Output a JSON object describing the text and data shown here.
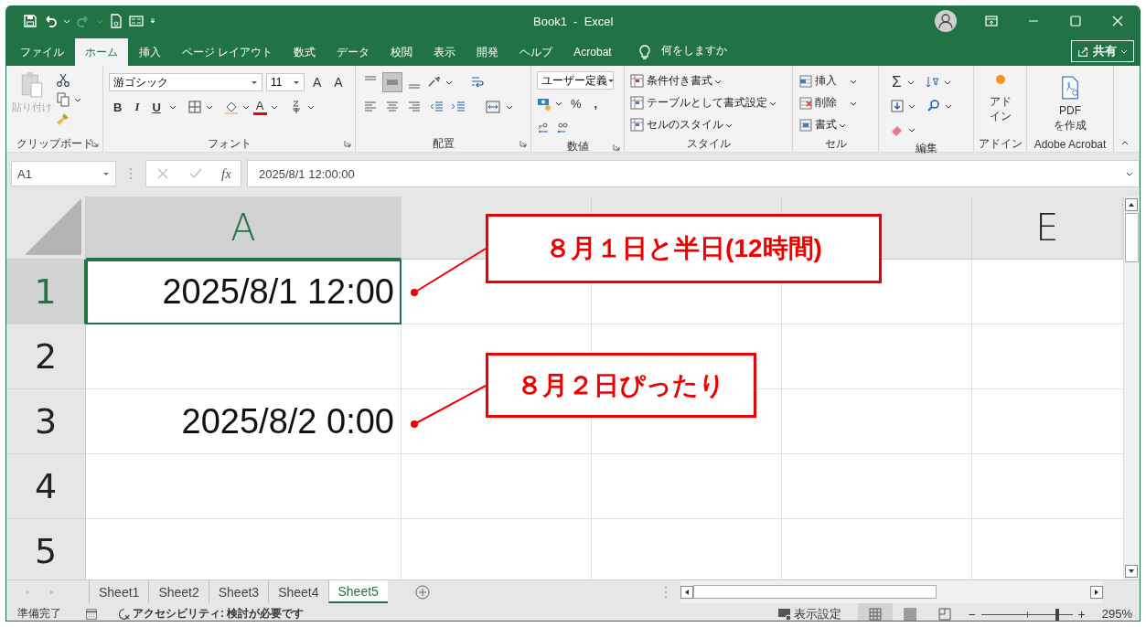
{
  "window": {
    "title": "Book1  -  Excel"
  },
  "ribbon_tabs": [
    {
      "label": "ファイル",
      "selected": false
    },
    {
      "label": "ホーム",
      "selected": true
    },
    {
      "label": "挿入",
      "selected": false
    },
    {
      "label": "ページ レイアウト",
      "selected": false
    },
    {
      "label": "数式",
      "selected": false
    },
    {
      "label": "データ",
      "selected": false
    },
    {
      "label": "校閲",
      "selected": false
    },
    {
      "label": "表示",
      "selected": false
    },
    {
      "label": "開発",
      "selected": false
    },
    {
      "label": "ヘルプ",
      "selected": false
    },
    {
      "label": "Acrobat",
      "selected": false
    }
  ],
  "tell_me": "何をしますか",
  "share_button": "共有",
  "ribbon": {
    "clipboard": {
      "label": "クリップボード",
      "paste": "貼り付け"
    },
    "font": {
      "label": "フォント",
      "font_name": "游ゴシック",
      "font_size": "11",
      "grow": "A",
      "shrink": "A",
      "bold": "B",
      "italic": "I",
      "underline": "U",
      "font_color": "A"
    },
    "alignment": {
      "label": "配置",
      "vertical": [
        {
          "selected": false
        },
        {
          "selected": true
        },
        {
          "selected": false
        }
      ]
    },
    "number": {
      "label": "数値",
      "format": "ユーザー定義",
      "percent": "%",
      "comma": ","
    },
    "styles": {
      "label": "スタイル",
      "items": [
        "条件付き書式",
        "テーブルとして書式設定",
        "セルのスタイル"
      ]
    },
    "cells": {
      "label": "セル",
      "items": [
        "挿入",
        "削除",
        "書式"
      ]
    },
    "editing": {
      "label": "編集",
      "sum": "Σ"
    },
    "addins": {
      "label": "アドイン",
      "button": "アドイン"
    },
    "acrobat": {
      "label": "Adobe Acrobat",
      "button": "PDF を作成"
    }
  },
  "formula_bar": {
    "name_box": "A1",
    "function_label": "fx",
    "formula": "2025/8/1  12:00:00"
  },
  "columns": [
    {
      "label": "A",
      "selected": true
    },
    {
      "selected": false
    },
    {
      "selected": false
    },
    {
      "selected": false
    },
    {
      "label": "E",
      "selected": false
    }
  ],
  "rows": [
    {
      "label": "1",
      "selected": true,
      "cell_a": "2025/8/1 12:00"
    },
    {
      "label": "2",
      "selected": false
    },
    {
      "label": "3",
      "selected": false,
      "cell_a": "2025/8/2 0:00"
    },
    {
      "label": "4",
      "selected": false
    },
    {
      "label": "5",
      "selected": false
    }
  ],
  "callouts": [
    {
      "text": "８月１日と半日(12時間)"
    },
    {
      "text": "８月２日ぴったり"
    }
  ],
  "sheet_tabs": [
    {
      "label": "Sheet1",
      "selected": false
    },
    {
      "label": "Sheet2",
      "selected": false
    },
    {
      "label": "Sheet3",
      "selected": false
    },
    {
      "label": "Sheet4",
      "selected": false
    },
    {
      "label": "Sheet5",
      "selected": true
    }
  ],
  "status_bar": {
    "ready": "準備完了",
    "accessibility": "アクセシビリティ: 検討が必要です",
    "display_settings": "表示設定",
    "views": [
      {
        "selected": true
      },
      {
        "selected": false
      },
      {
        "selected": false
      }
    ],
    "zoom_out": "−",
    "zoom_in": "+",
    "zoom": {
      "level": 0.83,
      "reading": "295%"
    }
  }
}
